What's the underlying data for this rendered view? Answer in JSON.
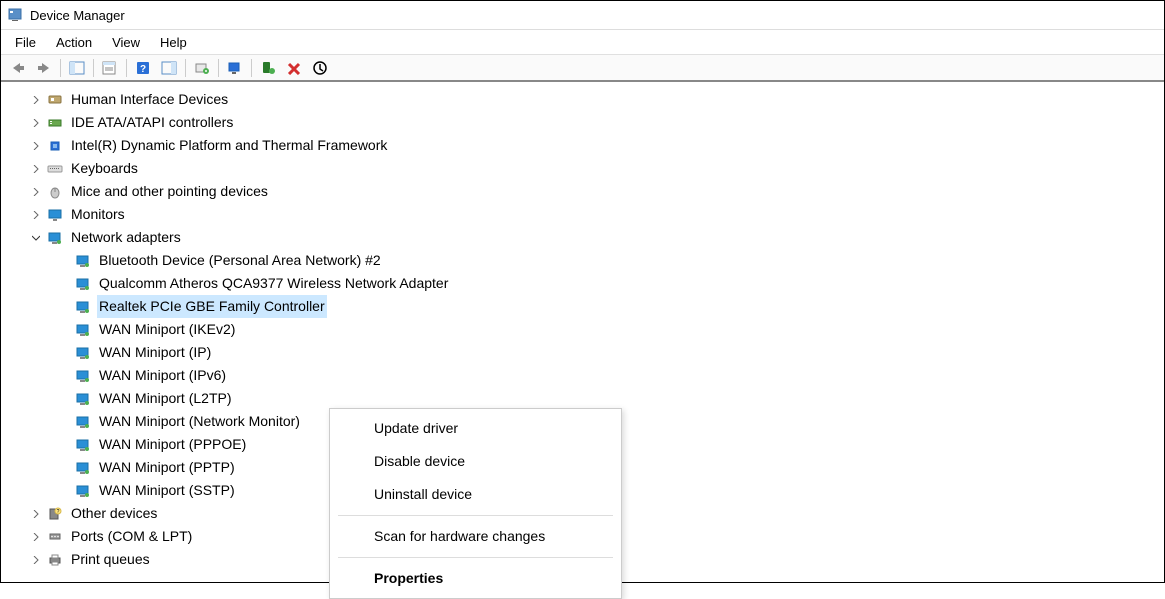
{
  "window": {
    "title": "Device Manager"
  },
  "menu": {
    "file": "File",
    "action": "Action",
    "view": "View",
    "help": "Help"
  },
  "tree": {
    "items": [
      {
        "label": "Human Interface Devices",
        "icon": "hid"
      },
      {
        "label": "IDE ATA/ATAPI controllers",
        "icon": "ide"
      },
      {
        "label": "Intel(R) Dynamic Platform and Thermal Framework",
        "icon": "cpu"
      },
      {
        "label": "Keyboards",
        "icon": "keyboard"
      },
      {
        "label": "Mice and other pointing devices",
        "icon": "mouse"
      },
      {
        "label": "Monitors",
        "icon": "monitor"
      },
      {
        "label": "Network adapters",
        "icon": "net",
        "expanded": true,
        "children": [
          {
            "label": "Bluetooth Device (Personal Area Network) #2"
          },
          {
            "label": "Qualcomm Atheros QCA9377 Wireless Network Adapter"
          },
          {
            "label": "Realtek PCIe GBE Family Controller",
            "selected": true
          },
          {
            "label": "WAN Miniport (IKEv2)"
          },
          {
            "label": "WAN Miniport (IP)"
          },
          {
            "label": "WAN Miniport (IPv6)"
          },
          {
            "label": "WAN Miniport (L2TP)"
          },
          {
            "label": "WAN Miniport (Network Monitor)"
          },
          {
            "label": "WAN Miniport (PPPOE)"
          },
          {
            "label": "WAN Miniport (PPTP)"
          },
          {
            "label": "WAN Miniport (SSTP)"
          }
        ]
      },
      {
        "label": "Other devices",
        "icon": "other"
      },
      {
        "label": "Ports (COM & LPT)",
        "icon": "port"
      },
      {
        "label": "Print queues",
        "icon": "printer"
      }
    ]
  },
  "context_menu": {
    "update": "Update driver",
    "disable": "Disable device",
    "uninstall": "Uninstall device",
    "scan": "Scan for hardware changes",
    "properties": "Properties"
  }
}
